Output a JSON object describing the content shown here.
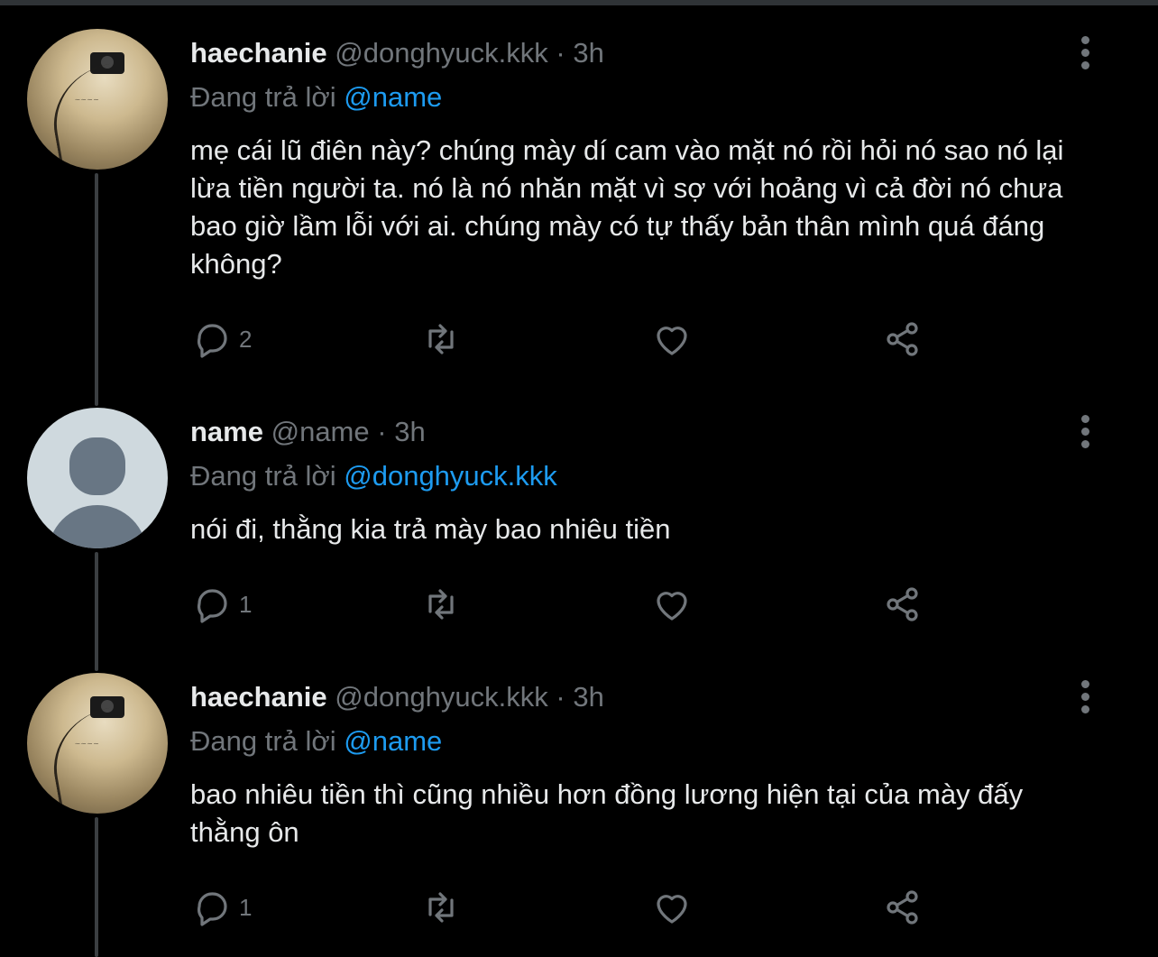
{
  "tweets": [
    {
      "display_name": "haechanie",
      "handle": "@donghyuck.kkk",
      "time": "3h",
      "reply_prefix": "Đang trả lời",
      "reply_to": "@name",
      "text": "mẹ cái lũ điên này? chúng mày dí cam vào mặt nó rồi hỏi nó sao nó lại lừa tiền người ta. nó là nó nhăn mặt vì sợ với hoảng vì cả đời nó chưa bao giờ lầm lỗi với ai. chúng mày có tự thấy bản thân mình quá đáng không?",
      "reply_count": "2",
      "avatar": "photo-avatar"
    },
    {
      "display_name": "name",
      "handle": "@name",
      "time": "3h",
      "reply_prefix": "Đang trả lời",
      "reply_to": "@donghyuck.kkk",
      "text": "nói đi, thằng kia trả mày bao nhiêu tiền",
      "reply_count": "1",
      "avatar": "default-avatar"
    },
    {
      "display_name": "haechanie",
      "handle": "@donghyuck.kkk",
      "time": "3h",
      "reply_prefix": "Đang trả lời",
      "reply_to": "@name",
      "text": "bao nhiêu tiền thì cũng nhiều hơn đồng lương hiện tại của mày đấy thằng ôn",
      "reply_count": "1",
      "avatar": "photo-avatar"
    }
  ],
  "dot_separator": "·",
  "icons": [
    "reply-icon",
    "retweet-icon",
    "like-icon",
    "share-icon",
    "more-icon"
  ],
  "colors": {
    "background": "#000000",
    "text": "#e7e9ea",
    "muted": "#71767b",
    "link": "#1d9bf0"
  }
}
